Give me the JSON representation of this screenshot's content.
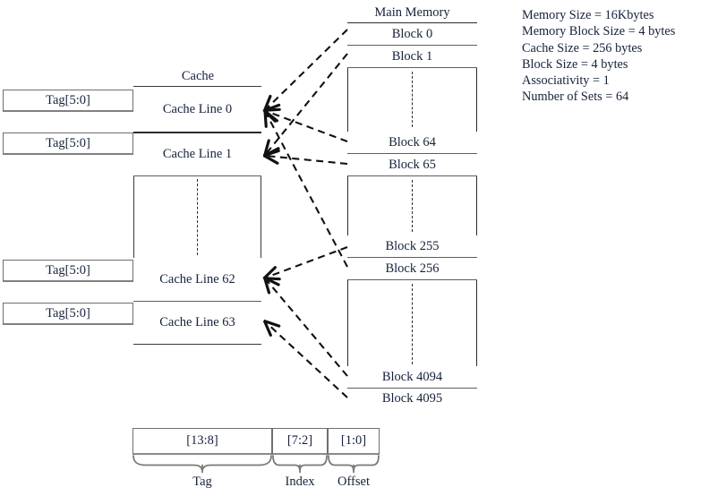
{
  "diagram": {
    "cache_title": "Cache",
    "memory_title": "Main Memory"
  },
  "cache": {
    "tag_label": "Tag[5:0]",
    "tags": [
      {
        "label": "Tag[5:0]"
      },
      {
        "label": "Tag[5:0]"
      },
      {
        "label": "Tag[5:0]"
      },
      {
        "label": "Tag[5:0]"
      }
    ],
    "lines": [
      {
        "label": "Cache Line 0"
      },
      {
        "label": "Cache Line 1"
      },
      {
        "label": "Cache Line 62"
      },
      {
        "label": "Cache Line 63"
      }
    ],
    "ellipsis": "vertical-dashed"
  },
  "memory": {
    "blocks": [
      {
        "label": "Block 0"
      },
      {
        "label": "Block 1"
      },
      {
        "label": "Block 64"
      },
      {
        "label": "Block 65"
      },
      {
        "label": "Block 255"
      },
      {
        "label": "Block 256"
      },
      {
        "label": "Block 4094"
      },
      {
        "label": "Block 4095"
      }
    ]
  },
  "specs": {
    "lines": [
      "Memory Size = 16Kbytes",
      "Memory Block Size = 4 bytes",
      "Cache Size = 256 bytes",
      "Block Size = 4 bytes",
      "Associativity = 1",
      "Number of Sets = 64"
    ]
  },
  "address": {
    "fields": [
      {
        "range": "[13:8]",
        "name": "Tag"
      },
      {
        "range": "[7:2]",
        "name": "Index"
      },
      {
        "range": "[1:0]",
        "name": "Offset"
      }
    ]
  },
  "colors": {
    "ink": "#16213a",
    "line": "#2b2b2b",
    "gray_border": "#6f6f6f",
    "background": "#ffffff"
  }
}
